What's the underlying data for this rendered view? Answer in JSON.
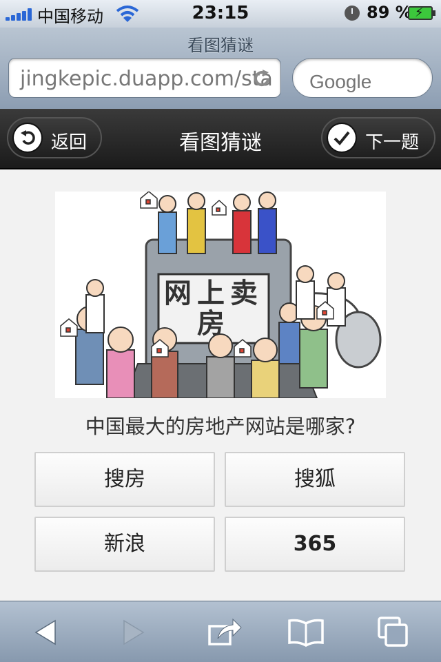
{
  "status_bar": {
    "carrier": "中国移动",
    "time": "23:15",
    "battery_percent": "89 %"
  },
  "safari": {
    "page_title": "看图猜谜",
    "url": "jingkepic.duapp.com/sta",
    "search_placeholder": "Google"
  },
  "header": {
    "back_label": "返回",
    "title": "看图猜谜",
    "next_label": "下一题"
  },
  "puzzle": {
    "image_text": "网上卖房",
    "question": "中国最大的房地产网站是哪家?",
    "answers": [
      "搜房",
      "搜狐",
      "新浪",
      "365"
    ]
  },
  "toolbar": {
    "icons": [
      "back-arrow-icon",
      "forward-arrow-icon",
      "share-icon",
      "bookmarks-icon",
      "tabs-icon"
    ]
  },
  "colors": {
    "signal_blue": "#2a67d6",
    "battery_green": "#3cc83c",
    "header_dark": "#1b1b1b"
  }
}
